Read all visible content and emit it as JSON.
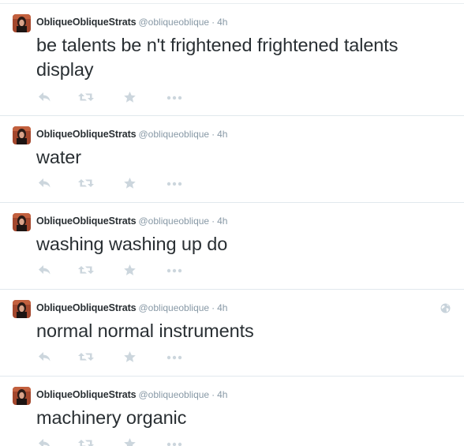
{
  "tweets": [
    {
      "fullname": "ObliqueObliqueStrats",
      "username": "@obliqueoblique",
      "separator": "·",
      "time": "4h",
      "text": "be talents be n't frightened frightened talents display",
      "globe": false
    },
    {
      "fullname": "ObliqueObliqueStrats",
      "username": "@obliqueoblique",
      "separator": "·",
      "time": "4h",
      "text": "water",
      "globe": false
    },
    {
      "fullname": "ObliqueObliqueStrats",
      "username": "@obliqueoblique",
      "separator": "·",
      "time": "4h",
      "text": "washing washing up do",
      "globe": false
    },
    {
      "fullname": "ObliqueObliqueStrats",
      "username": "@obliqueoblique",
      "separator": "·",
      "time": "4h",
      "text": "normal normal instruments",
      "globe": true
    },
    {
      "fullname": "ObliqueObliqueStrats",
      "username": "@obliqueoblique",
      "separator": "·",
      "time": "4h",
      "text": "machinery organic",
      "globe": false
    }
  ],
  "icons": {
    "reply": "reply-icon",
    "retweet": "retweet-icon",
    "favorite": "favorite-icon",
    "more": "more-icon",
    "globe": "globe-icon"
  },
  "colors": {
    "text": "#292f33",
    "muted": "#8899a6",
    "action_icon": "#ccd6dd",
    "divider": "#e1e8ed"
  }
}
